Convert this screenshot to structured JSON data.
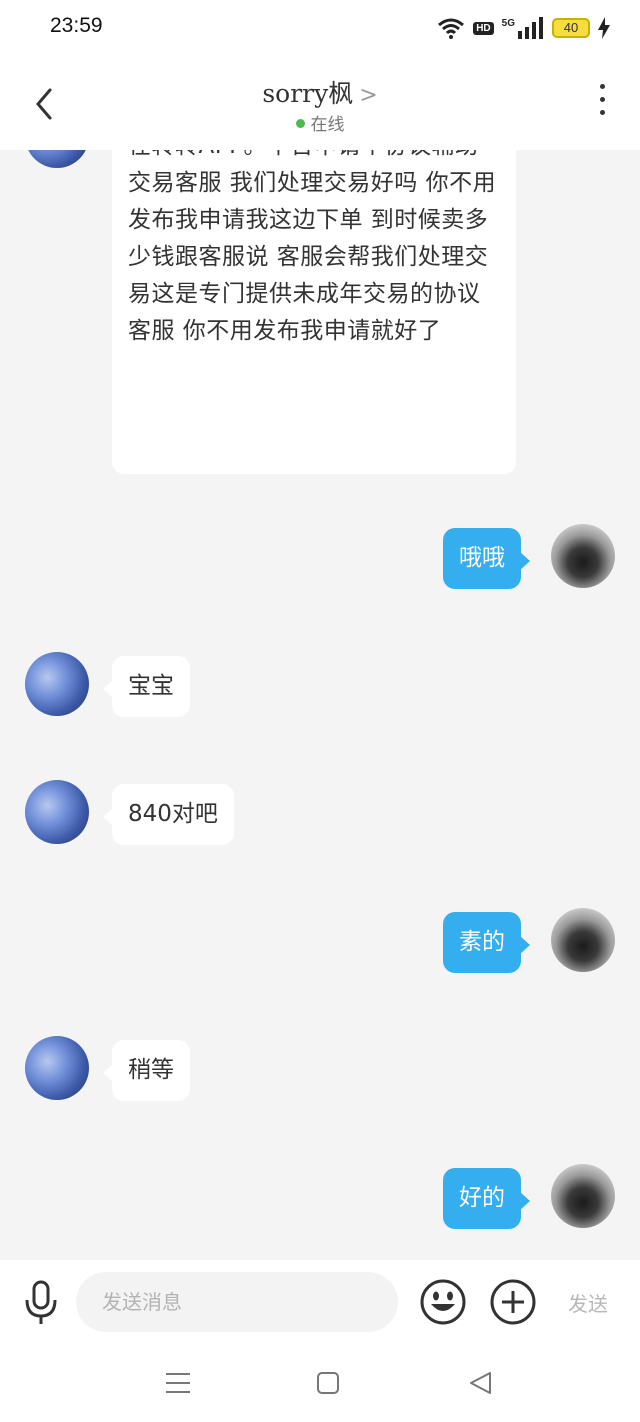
{
  "status_bar": {
    "time": "23:59",
    "hd": "HD",
    "network": "5G",
    "battery": "40",
    "icons": [
      "wifi-icon",
      "hd-icon",
      "signal-icon",
      "battery-icon",
      "charging-icon"
    ]
  },
  "header": {
    "contact_name": "sorry枫",
    "arrow": ">",
    "status": "在线",
    "status_color": "#4cbb4c"
  },
  "messages": [
    {
      "side": "left",
      "text": "在转转APP。平台申请个协议辅助交易客服 我们处理交易好吗 你不用发布我申请我这边下单 到时候卖多少钱跟客服说 客服会帮我们处理交易这是专门提供未成年交易的协议客服 你不用发布我申请就好了"
    },
    {
      "side": "right",
      "text": "哦哦"
    },
    {
      "side": "left",
      "text": "宝宝"
    },
    {
      "side": "left",
      "text": "840对吧"
    },
    {
      "side": "right",
      "text": "素的"
    },
    {
      "side": "left",
      "text": "稍等"
    },
    {
      "side": "right",
      "text": "好的"
    }
  ],
  "input_bar": {
    "placeholder": "发送消息",
    "send_label": "发送",
    "icons": [
      "microphone-icon",
      "emoji-icon",
      "plus-icon"
    ]
  },
  "nav_bar": {
    "icons": [
      "menu-icon",
      "home-icon",
      "back-triangle-icon"
    ]
  },
  "colors": {
    "outgoing_bubble": "#35aeef",
    "incoming_bubble": "#ffffff",
    "chat_background": "#f4f4f4"
  }
}
